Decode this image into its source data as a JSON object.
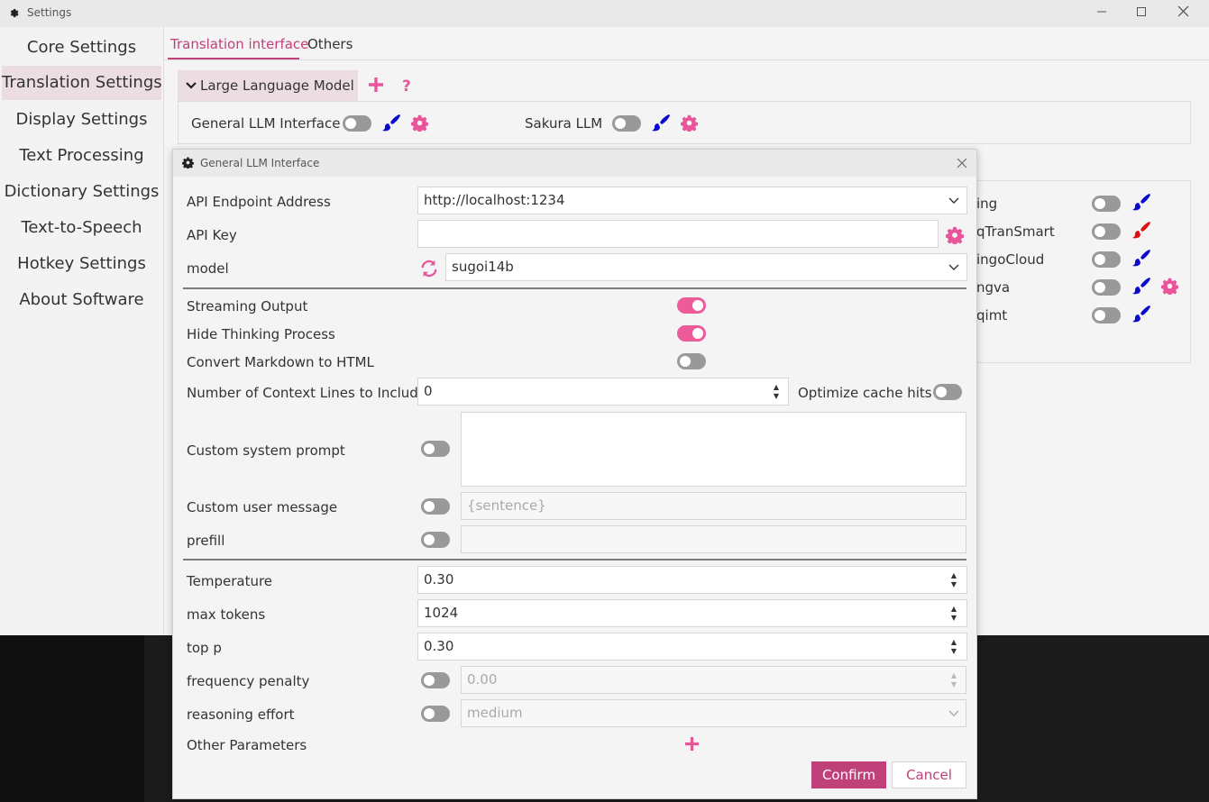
{
  "window": {
    "title": "Settings"
  },
  "sidebar": {
    "items": [
      {
        "label": "Core Settings"
      },
      {
        "label": "Translation Settings"
      },
      {
        "label": "Display Settings"
      },
      {
        "label": "Text Processing"
      },
      {
        "label": "Dictionary Settings"
      },
      {
        "label": "Text-to-Speech"
      },
      {
        "label": "Hotkey Settings"
      },
      {
        "label": "About Software"
      }
    ],
    "active_index": 1
  },
  "tabs": [
    {
      "label": "Translation interface"
    },
    {
      "label": "Others"
    }
  ],
  "llm_group": {
    "header": "Large Language Model",
    "header_icon": "chevron-down-icon",
    "items": [
      {
        "label": "General LLM Interface",
        "enabled": false
      },
      {
        "label": "Sakura LLM",
        "enabled": false
      }
    ]
  },
  "background_list": [
    {
      "label": "ing",
      "enabled": false,
      "brush_color": "#0a0acc"
    },
    {
      "label": "qTranSmart",
      "enabled": false,
      "brush_color": "#e01010"
    },
    {
      "label": "ingoCloud",
      "enabled": false,
      "brush_color": "#0a0acc"
    },
    {
      "label": "ngva",
      "enabled": false,
      "brush_color": "#0a0acc"
    },
    {
      "label": "qimt",
      "enabled": false,
      "brush_color": "#0a0acc"
    }
  ],
  "dialog": {
    "title": "General LLM Interface",
    "api_endpoint": {
      "label": "API Endpoint Address",
      "value": "http://localhost:1234"
    },
    "api_key": {
      "label": "API Key",
      "value": ""
    },
    "model": {
      "label": "model",
      "value": "sugoi14b"
    },
    "streaming_output": {
      "label": "Streaming Output",
      "enabled": true
    },
    "hide_thinking": {
      "label": "Hide Thinking Process",
      "enabled": true
    },
    "convert_markdown": {
      "label": "Convert Markdown to HTML",
      "enabled": false
    },
    "context_lines": {
      "label": "Number of Context Lines to Include",
      "value": "0"
    },
    "optimize_cache": {
      "label": "Optimize cache hits",
      "enabled": false
    },
    "custom_system_prompt": {
      "label": "Custom system prompt",
      "enabled": false,
      "value": ""
    },
    "custom_user_message": {
      "label": "Custom user message",
      "enabled": false,
      "value": "{sentence}"
    },
    "prefill": {
      "label": "prefill",
      "enabled": false,
      "value": ""
    },
    "temperature": {
      "label": "Temperature",
      "value": "0.30"
    },
    "max_tokens": {
      "label": "max tokens",
      "value": "1024"
    },
    "top_p": {
      "label": "top p",
      "value": "0.30"
    },
    "frequency_penalty": {
      "label": "frequency penalty",
      "enabled": false,
      "value": "0.00"
    },
    "reasoning_effort": {
      "label": "reasoning effort",
      "enabled": false,
      "value": "medium"
    },
    "other_parameters": {
      "label": "Other Parameters"
    },
    "confirm_label": "Confirm",
    "cancel_label": "Cancel"
  },
  "colors": {
    "accent": "#c0407a",
    "toggle_on": "#ee5b9b",
    "icon_pink": "#e8559a",
    "brush_blue": "#0a0acc"
  }
}
